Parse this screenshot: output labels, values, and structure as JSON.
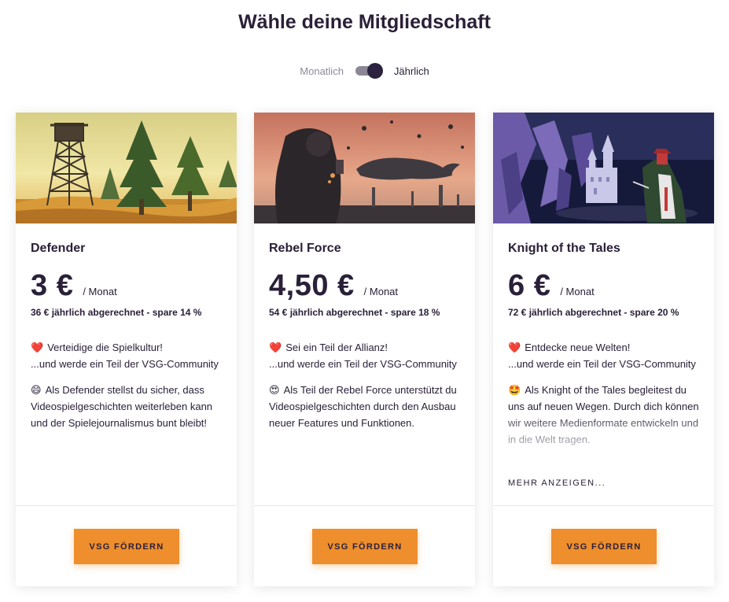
{
  "header": {
    "title": "Wähle deine Mitgliedschaft"
  },
  "billing_toggle": {
    "monthly_label": "Monatlich",
    "yearly_label": "Jährlich",
    "selected": "Jährlich"
  },
  "colors": {
    "accent": "#ef8e2c",
    "text": "#2a2038",
    "muted": "#8f8a97"
  },
  "plans": [
    {
      "name": "Defender",
      "price": "3 €",
      "period": "/ Monat",
      "billed": "36 € jährlich abgerechnet - spare 14 %",
      "line1_emoji": "❤️",
      "line1": "Verteidige die Spielkultur!",
      "line2": "...und werde ein Teil der VSG-Community",
      "line3_emoji": "😄",
      "line3": "Als Defender stellst du sicher, dass Videospielgeschichten weiterleben kann und der Spielejournalismus bunt bleibt!",
      "cta": "VSG FÖRDERN",
      "image_icon": "fire-lookout-forest-image"
    },
    {
      "name": "Rebel Force",
      "price": "4,50 €",
      "period": "/ Monat",
      "billed": "54 € jährlich abgerechnet - spare 18 %",
      "line1_emoji": "❤️",
      "line1": "Sei ein Teil der Allianz!",
      "line2": "...und werde ein Teil der VSG-Community",
      "line3_emoji": "😍",
      "line3": "Als Teil der Rebel Force unterstützt du Videospielgeschichten durch den Ausbau neuer Features und Funktionen.",
      "cta": "VSG FÖRDERN",
      "image_icon": "astronaut-whale-image"
    },
    {
      "name": "Knight of the Tales",
      "price": "6 €",
      "period": "/ Monat",
      "billed": "72 € jährlich abgerechnet - spare 20 %",
      "line1_emoji": "❤️",
      "line1": "Entdecke neue Welten!",
      "line2": "...und werde ein Teil der VSG-Community",
      "line3_emoji": "🤩",
      "line3": "Als Knight of the Tales begleitest du uns auf neuen Wegen. Durch dich können wir weitere Medienformate entwickeln und in die Welt tragen.",
      "more": "MEHR ANZEIGEN...",
      "cta": "VSG FÖRDERN",
      "image_icon": "pixel-castle-knight-image"
    }
  ]
}
